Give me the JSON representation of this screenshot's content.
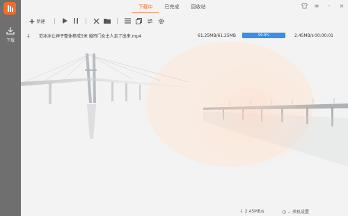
{
  "app": {
    "brand_color": "#ef6d2c",
    "accent_color": "#3a8ee6"
  },
  "sidebar": {
    "download_label": "下载"
  },
  "tabs": [
    {
      "label": "下载中",
      "active": true
    },
    {
      "label": "已完成",
      "active": false
    },
    {
      "label": "回收站",
      "active": false
    }
  ],
  "window_controls": {
    "skin": "shirt-icon",
    "menu": "≡",
    "minimize": "–",
    "close": "×"
  },
  "toolbar": {
    "new_label": "新建",
    "icons": [
      "play-icon",
      "pause-icon",
      "delete-icon",
      "folder-icon",
      "list-icon",
      "copy-icon",
      "refresh-icon",
      "settings-icon"
    ]
  },
  "downloads": [
    {
      "filename": "范冰冰让婷子整体移成5米 婚帘门女主人走了出来.mp4",
      "size": "61.25MB/61.25MB",
      "progress_text": "99.9%",
      "progress": 0.999,
      "speed": "2.45MB/s",
      "eta": "00:00:01"
    }
  ],
  "statusbar": {
    "speed": "2.45MB/s",
    "shutdown_label": "关机设置"
  }
}
